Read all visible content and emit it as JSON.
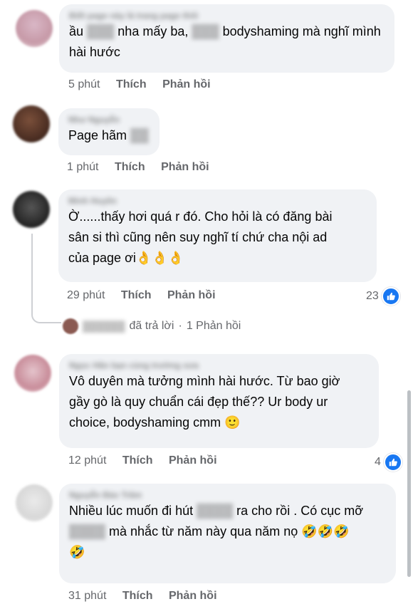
{
  "comments": [
    {
      "author": "Biết page này là trang page thôi",
      "text_lines": [
        "ầu ██ nha mấy ba, ██ bodyshaming mà nghĩ mình",
        "hài hước"
      ],
      "time": "5 phút",
      "like_label": "Thích",
      "reply_label": "Phản hồi"
    },
    {
      "author": "Như Nguyễn",
      "text_prefix": "Page hãm",
      "time": "1 phút",
      "like_label": "Thích",
      "reply_label": "Phản hồi"
    },
    {
      "author": "Minh Huyền",
      "text_lines": [
        "Ờ......thấy hơi quá r đó. Cho hỏi là có đăng bài",
        "sân si thì cũng nên suy nghĩ tí chứ cha nội ad",
        "của page ơi"
      ],
      "emojis": [
        "👌",
        "👌",
        "👌"
      ],
      "time": "29 phút",
      "like_label": "Thích",
      "reply_label": "Phản hồi",
      "reaction_count": "23",
      "reply_summary": {
        "replied_text": "đã trả lời",
        "separator": "·",
        "count_text": "1 Phản hồi"
      }
    },
    {
      "author": "Ngọc Hân bạn cùng trường xưa",
      "text_lines": [
        "Vô duyên mà tưởng mình hài hước. Từ bao giờ",
        "gầy gò là quy chuẩn cái đẹp thế?? Ur body ur",
        "choice, bodyshaming cmm"
      ],
      "emoji": "🙂",
      "time": "12 phút",
      "like_label": "Thích",
      "reply_label": "Phản hồi",
      "reaction_count": "4"
    },
    {
      "author": "Nguyễn Bảo Trâm",
      "line1_a": "Nhiều lúc muốn đi hút",
      "line1_b": "ra cho rồi . Có cục mỡ",
      "line2": "mà nhắc từ năm này qua năm nọ",
      "emojis": [
        "🤣",
        "🤣",
        "🤣",
        "🤣"
      ],
      "time": "31 phút",
      "like_label": "Thích",
      "reply_label": "Phản hồi"
    }
  ],
  "colors": {
    "bubble": "#f0f2f5",
    "meta": "#65676b",
    "like": "#1877f2"
  }
}
